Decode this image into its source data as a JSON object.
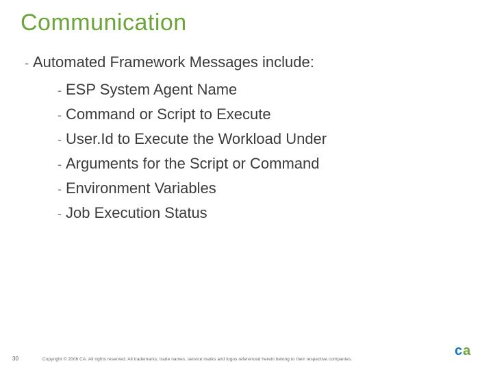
{
  "title": "Communication",
  "intro": "Automated Framework Messages include:",
  "bullets": [
    "ESP System Agent Name",
    "Command or Script to Execute",
    "User.Id to Execute the Workload Under",
    "Arguments for the Script or Command",
    "Environment Variables",
    "Job Execution Status"
  ],
  "page_number": "30",
  "copyright": "Copyright © 2006 CA. All rights reserved. All trademarks, trade names, service marks and logos referenced herein belong to their respective companies.",
  "logo_label": "ca",
  "colors": {
    "accent": "#6ba53a",
    "logo_blue": "#0a78c2",
    "logo_green": "#6ba53a"
  }
}
